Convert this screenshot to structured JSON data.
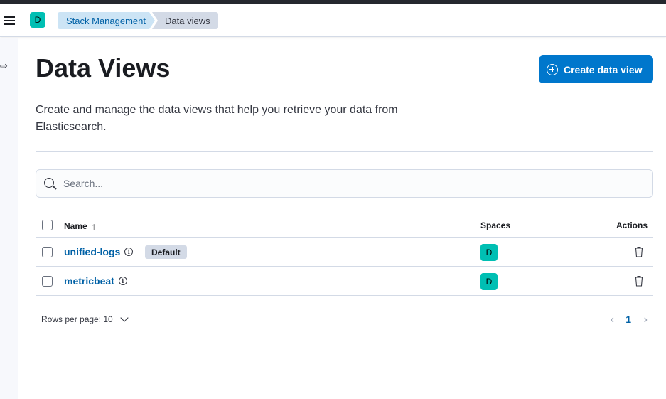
{
  "header": {
    "space_initial": "D",
    "breadcrumbs": [
      "Stack Management",
      "Data views"
    ]
  },
  "page": {
    "title": "Data Views",
    "create_button": "Create data view",
    "description": "Create and manage the data views that help you retrieve your data from Elasticsearch.",
    "search_placeholder": "Search..."
  },
  "table": {
    "columns": {
      "name": "Name",
      "spaces": "Spaces",
      "actions": "Actions"
    },
    "sort_direction": "ascending",
    "rows": [
      {
        "name": "unified-logs",
        "badge": "Default",
        "space": "D"
      },
      {
        "name": "metricbeat",
        "badge": "",
        "space": "D"
      }
    ]
  },
  "pagination": {
    "rows_per_page": "Rows per page: 10",
    "current_page": "1"
  },
  "colors": {
    "primary": "#0077cc",
    "link": "#0061a6",
    "space_avatar": "#00bfb3",
    "badge": "#d3dae6"
  },
  "icons": {
    "menu": "hamburger-icon",
    "collapse": "collapse-sidebar-icon",
    "create": "plus-circle-icon",
    "search": "search-icon",
    "sort": "arrow-up-icon",
    "info": "info-icon",
    "delete": "trash-icon",
    "dropdown": "chevron-down-icon",
    "prev": "chevron-left-icon",
    "next": "chevron-right-icon"
  }
}
